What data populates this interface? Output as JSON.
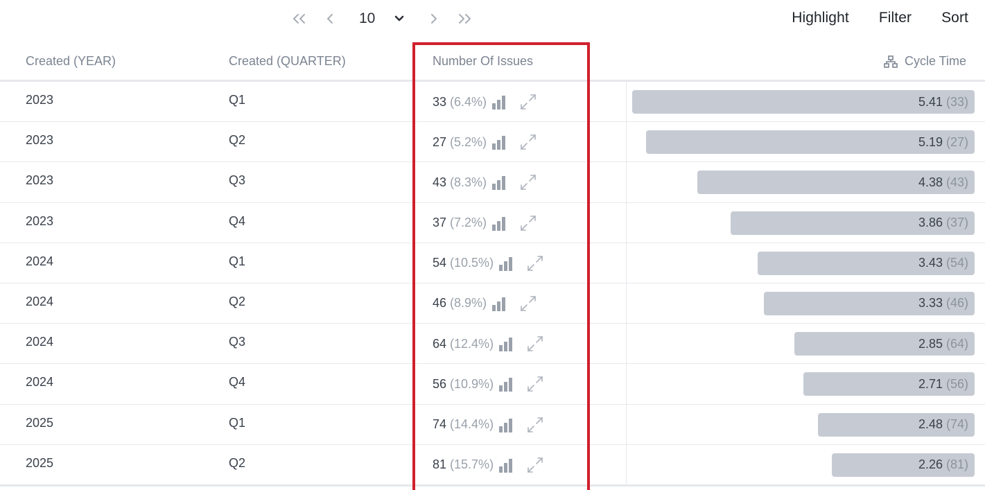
{
  "pager": {
    "page_size": "10"
  },
  "actions": {
    "highlight": "Highlight",
    "filter": "Filter",
    "sort": "Sort"
  },
  "columns": {
    "year": "Created (YEAR)",
    "quarter": "Created (QUARTER)",
    "issues": "Number Of Issues",
    "cycle": "Cycle Time"
  },
  "colors": {
    "highlight_border": "#d0202e",
    "bar_fill": "#c6cbd3",
    "header_text": "#7b8491"
  },
  "rows": [
    {
      "year": "2023",
      "quarter": "Q1",
      "count": "33",
      "pct": "(6.4%)",
      "cycle": "5.41",
      "cycle_count": "(33)",
      "cycle_value": 5.41
    },
    {
      "year": "2023",
      "quarter": "Q2",
      "count": "27",
      "pct": "(5.2%)",
      "cycle": "5.19",
      "cycle_count": "(27)",
      "cycle_value": 5.19
    },
    {
      "year": "2023",
      "quarter": "Q3",
      "count": "43",
      "pct": "(8.3%)",
      "cycle": "4.38",
      "cycle_count": "(43)",
      "cycle_value": 4.38
    },
    {
      "year": "2023",
      "quarter": "Q4",
      "count": "37",
      "pct": "(7.2%)",
      "cycle": "3.86",
      "cycle_count": "(37)",
      "cycle_value": 3.86
    },
    {
      "year": "2024",
      "quarter": "Q1",
      "count": "54",
      "pct": "(10.5%)",
      "cycle": "3.43",
      "cycle_count": "(54)",
      "cycle_value": 3.43
    },
    {
      "year": "2024",
      "quarter": "Q2",
      "count": "46",
      "pct": "(8.9%)",
      "cycle": "3.33",
      "cycle_count": "(46)",
      "cycle_value": 3.33
    },
    {
      "year": "2024",
      "quarter": "Q3",
      "count": "64",
      "pct": "(12.4%)",
      "cycle": "2.85",
      "cycle_count": "(64)",
      "cycle_value": 2.85
    },
    {
      "year": "2024",
      "quarter": "Q4",
      "count": "56",
      "pct": "(10.9%)",
      "cycle": "2.71",
      "cycle_count": "(56)",
      "cycle_value": 2.71
    },
    {
      "year": "2025",
      "quarter": "Q1",
      "count": "74",
      "pct": "(14.4%)",
      "cycle": "2.48",
      "cycle_count": "(74)",
      "cycle_value": 2.48
    },
    {
      "year": "2025",
      "quarter": "Q2",
      "count": "81",
      "pct": "(15.7%)",
      "cycle": "2.26",
      "cycle_count": "(81)",
      "cycle_value": 2.26
    }
  ],
  "icons": {
    "first": "double-chevron-left-icon",
    "prev": "chevron-left-icon",
    "dropdown": "chevron-down-icon",
    "next": "chevron-right-icon",
    "last": "double-chevron-right-icon",
    "cycle_header": "hierarchy-icon",
    "row_chart": "bar-chart-icon",
    "row_expand": "expand-icon"
  }
}
